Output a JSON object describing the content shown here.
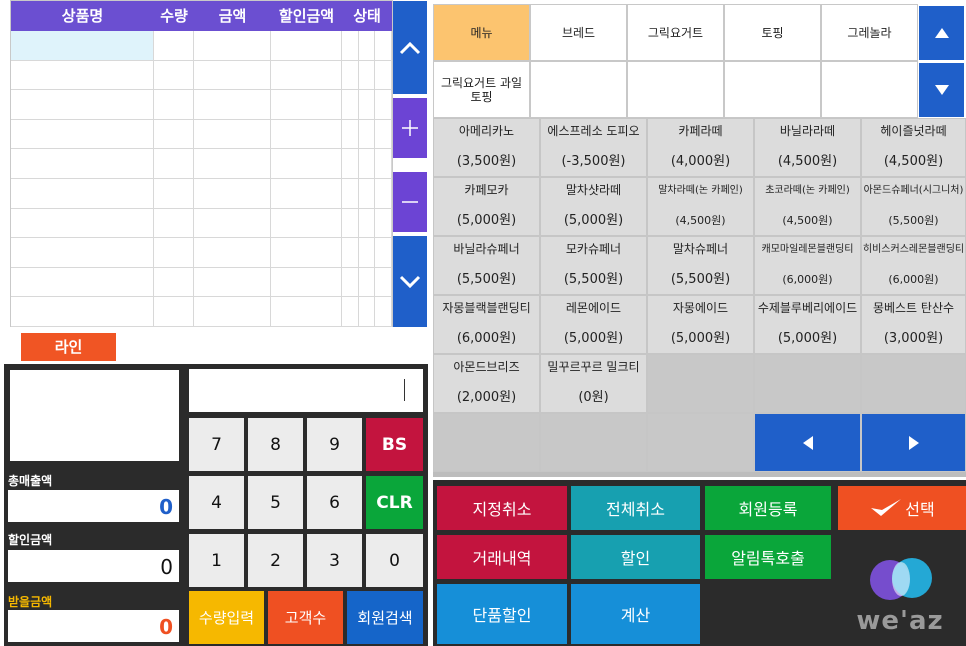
{
  "table": {
    "headers": [
      "상품명",
      "수량",
      "금액",
      "할인금액",
      "상태"
    ]
  },
  "line_tag": "라인",
  "summary": {
    "total_label": "총매출액",
    "total_value": "0",
    "discount_label": "할인금액",
    "discount_value": "0",
    "receive_label": "받을금액",
    "receive_value": "0"
  },
  "keypad": {
    "row1": [
      "7",
      "8",
      "9"
    ],
    "row2": [
      "4",
      "5",
      "6"
    ],
    "row3": [
      "1",
      "2",
      "3",
      "0"
    ],
    "bs": "BS",
    "clr": "CLR",
    "qty": "수량입력",
    "customers": "고객수",
    "member_search": "회원검색"
  },
  "tabs": {
    "row1": [
      "메뉴",
      "브레드",
      "그릭요거트",
      "토핑",
      "그레놀라"
    ],
    "row2": [
      "그릭요거트 과일\n토핑"
    ]
  },
  "products": [
    {
      "name": "아메리카노",
      "price": "(3,500원)"
    },
    {
      "name": "에스프레소 도피오",
      "price": "(-3,500원)"
    },
    {
      "name": "카페라떼",
      "price": "(4,000원)"
    },
    {
      "name": "바닐라라떼",
      "price": "(4,500원)"
    },
    {
      "name": "헤이즐넛라떼",
      "price": "(4,500원)"
    },
    {
      "name": "카페모카",
      "price": "(5,000원)"
    },
    {
      "name": "말차샷라떼",
      "price": "(5,000원)"
    },
    {
      "name": "말차라떼(논 카페인)",
      "price": "(4,500원)"
    },
    {
      "name": "초코라떼(논 카페인)",
      "price": "(4,500원)"
    },
    {
      "name": "아몬드슈페너(시그니처)",
      "price": "(5,500원)"
    },
    {
      "name": "바닐라슈페너",
      "price": "(5,500원)"
    },
    {
      "name": "모카슈페너",
      "price": "(5,500원)"
    },
    {
      "name": "말차슈페너",
      "price": "(5,500원)"
    },
    {
      "name": "캐모마일레몬블랜딩티",
      "price": "(6,000원)"
    },
    {
      "name": "히비스커스레몬블랜딩티",
      "price": "(6,000원)"
    },
    {
      "name": "자몽블랙블랜딩티",
      "price": "(6,000원)"
    },
    {
      "name": "레몬에이드",
      "price": "(5,000원)"
    },
    {
      "name": "자몽에이드",
      "price": "(5,000원)"
    },
    {
      "name": "수제블루베리에이드",
      "price": "(5,000원)"
    },
    {
      "name": "몽베스트 탄산수",
      "price": "(3,000원)"
    },
    {
      "name": "아몬드브리즈",
      "price": "(2,000원)"
    },
    {
      "name": "밀꾸르꾸르 밀크티",
      "price": "(0원)"
    }
  ],
  "actions": {
    "designated_cancel": "지정취소",
    "cancel_all": "전체취소",
    "member_register": "회원등록",
    "select": "선택",
    "transaction_history": "거래내역",
    "discount": "할인",
    "alimtalk_call": "알림톡호출",
    "item_discount": "단품할인",
    "checkout": "계산"
  },
  "logo_text": "we'az",
  "colors": {
    "header_purple": "#6b4fd1",
    "nav_blue": "#1f5fc9",
    "red": "#c3143e",
    "green": "#0aa63a",
    "orange": "#ef5022",
    "teal": "#17a0b0",
    "tab_active": "#fcc46f"
  }
}
